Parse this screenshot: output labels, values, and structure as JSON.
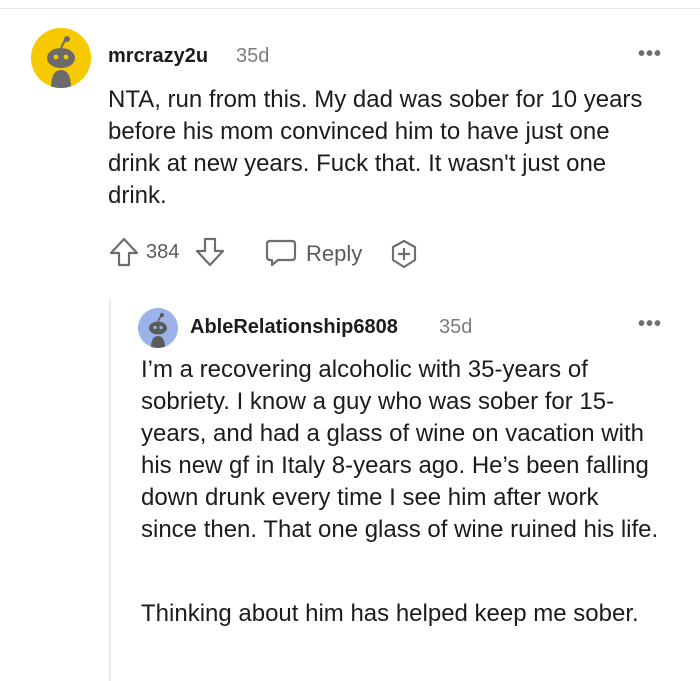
{
  "comment1": {
    "username": "mrcrazy2u",
    "age": "35d",
    "more_label": "•••",
    "body": "NTA, run from this. My dad was sober for 10 years before his mom convinced him to have just one drink at new years. Fuck that. It wasn't just one drink.",
    "score": "384",
    "reply_label": "Reply",
    "avatar_icon": "snoo-avatar-icon",
    "avatar_color": "#f7c900"
  },
  "comment2": {
    "username": "AbleRelationship6808",
    "age": "35d",
    "more_label": "•••",
    "paragraph1": "I’m a recovering alcoholic with 35-years of sobriety. I know a guy who was sober for 15-years, and had a glass of wine on vacation with his new gf in Italy 8-years ago. He’s been falling down drunk every time I see him after work since then. That one glass of wine ruined his life.",
    "paragraph2": "Thinking about him has helped keep me sober.",
    "avatar_icon": "snoo-avatar-icon",
    "avatar_color": "#9bb3e8"
  },
  "icons": {
    "upvote": "upvote-arrow-icon",
    "downvote": "downvote-arrow-icon",
    "reply": "speech-bubble-icon",
    "award": "award-plus-icon"
  }
}
